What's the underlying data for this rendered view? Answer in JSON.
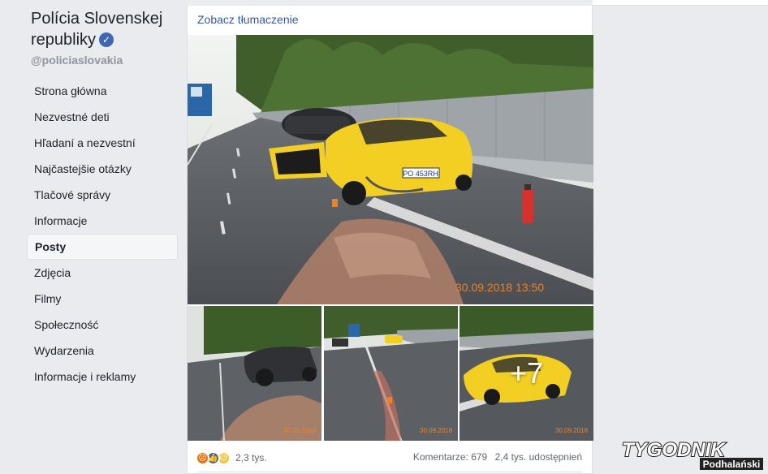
{
  "page": {
    "name": "Polícia Slovenskej republiky",
    "handle": "@policiaslovakia"
  },
  "nav": [
    {
      "label": "Strona główna"
    },
    {
      "label": "Nezvestné deti"
    },
    {
      "label": "Hľadaní a nezvestní"
    },
    {
      "label": "Najčastejšie otázky"
    },
    {
      "label": "Tlačové správy"
    },
    {
      "label": "Informacje"
    },
    {
      "label": "Posty",
      "active": true
    },
    {
      "label": "Zdjęcia"
    },
    {
      "label": "Filmy"
    },
    {
      "label": "Społeczność"
    },
    {
      "label": "Wydarzenia"
    },
    {
      "label": "Informacje i reklamy"
    }
  ],
  "post": {
    "translate_link": "Zobacz tłumaczenie",
    "main_photo_stamp": "30.09.2018 13:50",
    "thumb_stamps": [
      "30.09.2018",
      "30.09.2018",
      "30.09.2018"
    ],
    "more_count": "+7",
    "plate": "PO 453RH",
    "reactions_count": "2,3 tys.",
    "comments": "Komentarze: 679",
    "shares": "2,4 tys. udostępnień"
  },
  "watermark": {
    "line1": "TYGODNIK",
    "line2": "Podhalański"
  },
  "colors": {
    "link": "#385898",
    "brand": "#4267b2",
    "background": "#e9ebee"
  },
  "icons": [
    "verified-badge-icon",
    "angry-reaction-icon",
    "like-reaction-icon",
    "sad-reaction-icon"
  ]
}
